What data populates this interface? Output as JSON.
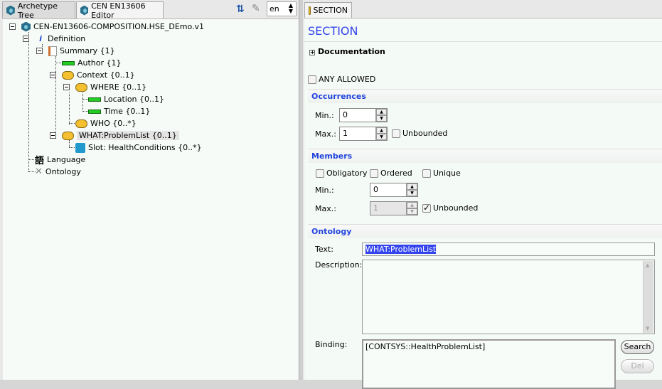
{
  "left": {
    "tabs": [
      {
        "label": "Archetype Tree"
      },
      {
        "label": "CEN EN13606 Editor"
      }
    ],
    "language": "en",
    "tree": {
      "root": "CEN-EN13606-COMPOSITION.HSE_DEmo.v1",
      "definition": "Definition",
      "summary": "Summary {1}",
      "author": "Author {1}",
      "context": "Context {0..1}",
      "where": "WHERE {0..1}",
      "location": "Location {0..1}",
      "time": "Time {0..1}",
      "who": "WHO {0..*}",
      "what": "WHAT:ProblemList {0..1}",
      "slot": "Slot: HealthConditions  {0..*}",
      "language": "Language",
      "ontology": "Ontology",
      "language_glyph": "語"
    }
  },
  "right": {
    "tab": "SECTION",
    "title": "SECTION",
    "documentation": "Documentation",
    "any_allowed": "ANY ALLOWED",
    "occurrences": {
      "header": "Occurrences",
      "min_label": "Min.:",
      "min": "0",
      "max_label": "Max.:",
      "max": "1",
      "unbounded": "Unbounded",
      "unbounded_checked": false
    },
    "members": {
      "header": "Members",
      "obligatory": "Obligatory",
      "ordered": "Ordered",
      "unique": "Unique",
      "min_label": "Min.:",
      "min": "0",
      "max_label": "Max.:",
      "max": "1",
      "unbounded": "Unbounded",
      "unbounded_checked": true
    },
    "ontology": {
      "header": "Ontology",
      "text_label": "Text:",
      "text": "WHAT:ProblemList",
      "description_label": "Description:",
      "description": "",
      "binding_label": "Binding:",
      "binding": "[CONTSYS::HealthProblemList]",
      "search": "Search",
      "del": "Del"
    }
  },
  "colors": {
    "accent": "#2244dd",
    "selection": "#3344ee"
  }
}
